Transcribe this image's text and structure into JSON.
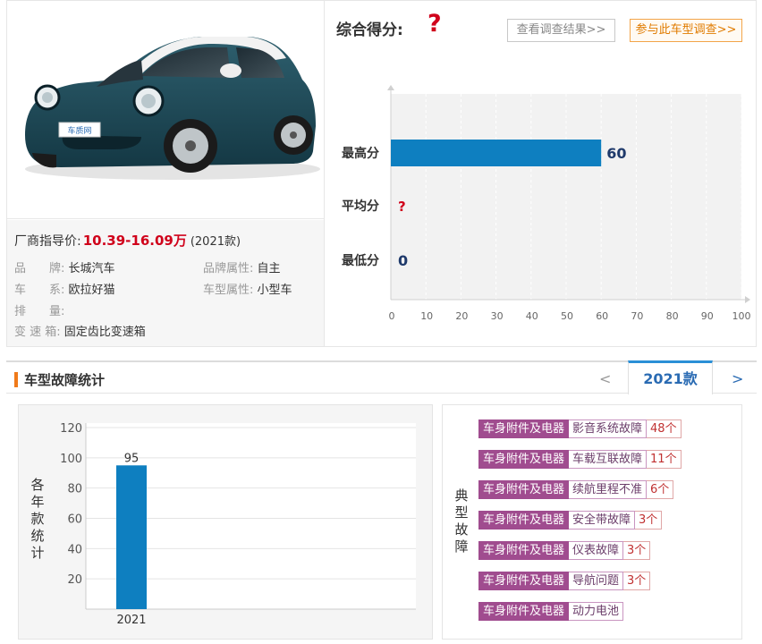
{
  "car": {
    "price_label": "厂商指导价:",
    "price_value": "10.39-16.09万",
    "price_year": "(2021款)",
    "plate_text": "车质网",
    "specs": [
      {
        "key": "品　　牌:",
        "value": "长城汽车"
      },
      {
        "key": "品牌属性:",
        "value": "自主"
      },
      {
        "key": "车　　系:",
        "value": "欧拉好猫"
      },
      {
        "key": "车型属性:",
        "value": "小型车"
      },
      {
        "key": "排　　量:",
        "value": ""
      },
      {
        "key": "变 速 箱:",
        "value": "固定齿比变速箱"
      }
    ]
  },
  "score": {
    "title": "综合得分:",
    "value": "?",
    "btn_view": "查看调查结果>>",
    "btn_join": "参与此车型调查>>"
  },
  "chart_data": [
    {
      "type": "bar",
      "orientation": "horizontal",
      "categories": [
        "最高分",
        "平均分",
        "最低分"
      ],
      "values": [
        60,
        null,
        0
      ],
      "value_labels": [
        "60",
        "?",
        "0"
      ],
      "xlim": [
        0,
        100
      ],
      "xticks": [
        0,
        10,
        20,
        30,
        40,
        50,
        60,
        70,
        80,
        90,
        100
      ],
      "grid": true,
      "bar_color": "#0e7fc0"
    },
    {
      "type": "bar",
      "categories": [
        "2021"
      ],
      "values": [
        95
      ],
      "ylim": [
        0,
        120
      ],
      "yticks": [
        20,
        40,
        60,
        80,
        100,
        120
      ],
      "ylabel": "各年款统计",
      "grid": true,
      "bar_color": "#0e7fc0"
    }
  ],
  "fault": {
    "title": "车型故障统计",
    "prev": "<",
    "year": "2021款",
    "next": ">",
    "count_label": "各年款统计",
    "typical_label": "典型故障",
    "items": [
      {
        "category": "车身附件及电器",
        "name": "影音系统故障",
        "count": "48个"
      },
      {
        "category": "车身附件及电器",
        "name": "车载互联故障",
        "count": "11个"
      },
      {
        "category": "车身附件及电器",
        "name": "续航里程不准",
        "count": "6个"
      },
      {
        "category": "车身附件及电器",
        "name": "安全带故障",
        "count": "3个"
      },
      {
        "category": "车身附件及电器",
        "name": "仪表故障",
        "count": "3个"
      },
      {
        "category": "车身附件及电器",
        "name": "导航问题",
        "count": "3个"
      },
      {
        "category": "车身附件及电器",
        "name": "动力电池",
        "count": ""
      }
    ]
  },
  "colors": {
    "accent_blue": "#0e7fc0",
    "price_red": "#d0021b",
    "fault_purple": "#a04c8f",
    "orange": "#f07a1a"
  }
}
